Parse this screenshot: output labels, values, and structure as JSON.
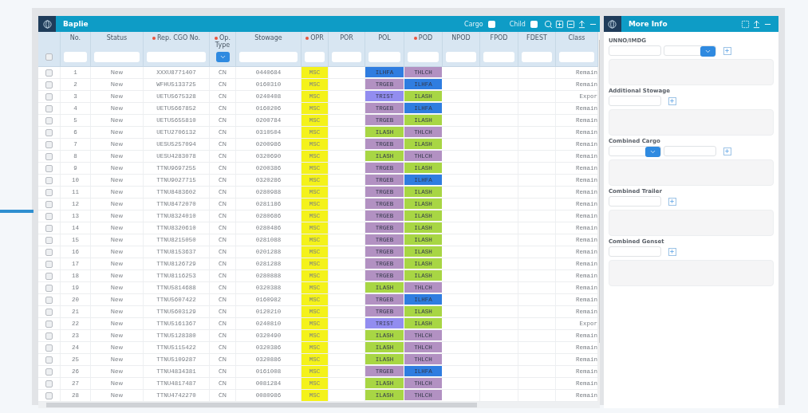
{
  "grid": {
    "title": "Baplie",
    "toggles": [
      {
        "label": "Cargo",
        "checked": false
      },
      {
        "label": "Child",
        "checked": false
      }
    ],
    "select_all": {
      "checked": false
    },
    "columns": [
      {
        "label": "No.",
        "required": false,
        "dropdown_filter": false
      },
      {
        "label": "Status",
        "required": false,
        "dropdown_filter": false
      },
      {
        "label": "Rep. CGO No.",
        "required": true,
        "dropdown_filter": false
      },
      {
        "label": "Op. Type",
        "required": true,
        "dropdown_filter": true
      },
      {
        "label": "Stowage",
        "required": false,
        "dropdown_filter": false
      },
      {
        "label": "OPR",
        "required": true,
        "dropdown_filter": false
      },
      {
        "label": "POR",
        "required": false,
        "dropdown_filter": false
      },
      {
        "label": "POL",
        "required": false,
        "dropdown_filter": false
      },
      {
        "label": "POD",
        "required": true,
        "dropdown_filter": false
      },
      {
        "label": "NPOD",
        "required": false,
        "dropdown_filter": false
      },
      {
        "label": "FPOD",
        "required": false,
        "dropdown_filter": false
      },
      {
        "label": "FDEST",
        "required": false,
        "dropdown_filter": false
      },
      {
        "label": "Class",
        "required": false,
        "dropdown_filter": false
      }
    ],
    "rows": [
      {
        "checked": false,
        "no": "1",
        "status": "New",
        "rep_cgo_no": "XXXU8771407",
        "op_type": "CN",
        "stowage": "0440684",
        "opr": "MSC",
        "pol": {
          "text": "ILHFA",
          "color": "#2f7de0"
        },
        "pod": {
          "text": "THLCH",
          "color": "#b291c2"
        },
        "class": "Remain"
      },
      {
        "checked": false,
        "no": "2",
        "status": "New",
        "rep_cgo_no": "WFHU5133725",
        "op_type": "CN",
        "stowage": "0160310",
        "opr": "MSC",
        "pol": {
          "text": "TRGEB",
          "color": "#b291c2"
        },
        "pod": {
          "text": "ILHFA",
          "color": "#2f7de0"
        },
        "class": "Remain"
      },
      {
        "checked": false,
        "no": "3",
        "status": "New",
        "rep_cgo_no": "UETU5675328",
        "op_type": "CN",
        "stowage": "0240408",
        "opr": "MSC",
        "pol": {
          "text": "TRIST",
          "color": "#928df0"
        },
        "pod": {
          "text": "ILASH",
          "color": "#a8d644"
        },
        "class": "Expor"
      },
      {
        "checked": false,
        "no": "4",
        "status": "New",
        "rep_cgo_no": "UETU5667852",
        "op_type": "CN",
        "stowage": "0160206",
        "opr": "MSC",
        "pol": {
          "text": "TRGEB",
          "color": "#b291c2"
        },
        "pod": {
          "text": "ILHFA",
          "color": "#2f7de0"
        },
        "class": "Remain"
      },
      {
        "checked": false,
        "no": "5",
        "status": "New",
        "rep_cgo_no": "UETU5655810",
        "op_type": "CN",
        "stowage": "0200784",
        "opr": "MSC",
        "pol": {
          "text": "TRGEB",
          "color": "#b291c2"
        },
        "pod": {
          "text": "ILASH",
          "color": "#a8d644"
        },
        "class": "Remain"
      },
      {
        "checked": false,
        "no": "6",
        "status": "New",
        "rep_cgo_no": "UETU2706132",
        "op_type": "CN",
        "stowage": "0310504",
        "opr": "MSC",
        "pol": {
          "text": "ILASH",
          "color": "#a8d644"
        },
        "pod": {
          "text": "THLCH",
          "color": "#b291c2"
        },
        "class": "Remain"
      },
      {
        "checked": false,
        "no": "7",
        "status": "New",
        "rep_cgo_no": "UESU5257094",
        "op_type": "CN",
        "stowage": "0200986",
        "opr": "MSC",
        "pol": {
          "text": "TRGEB",
          "color": "#b291c2"
        },
        "pod": {
          "text": "ILASH",
          "color": "#a8d644"
        },
        "class": "Remain"
      },
      {
        "checked": false,
        "no": "8",
        "status": "New",
        "rep_cgo_no": "UESU4283078",
        "op_type": "CN",
        "stowage": "0320690",
        "opr": "MSC",
        "pol": {
          "text": "ILASH",
          "color": "#a8d644"
        },
        "pod": {
          "text": "THLCH",
          "color": "#b291c2"
        },
        "class": "Remain"
      },
      {
        "checked": false,
        "no": "9",
        "status": "New",
        "rep_cgo_no": "TTNU9697255",
        "op_type": "CN",
        "stowage": "0200386",
        "opr": "MSC",
        "pol": {
          "text": "TRGEB",
          "color": "#b291c2"
        },
        "pod": {
          "text": "ILASH",
          "color": "#a8d644"
        },
        "class": "Remain"
      },
      {
        "checked": false,
        "no": "10",
        "status": "New",
        "rep_cgo_no": "TTNU9027715",
        "op_type": "CN",
        "stowage": "0320286",
        "opr": "MSC",
        "pol": {
          "text": "TRGEB",
          "color": "#b291c2"
        },
        "pod": {
          "text": "ILHFA",
          "color": "#2f7de0"
        },
        "class": "Remain"
      },
      {
        "checked": false,
        "no": "11",
        "status": "New",
        "rep_cgo_no": "TTNU8483602",
        "op_type": "CN",
        "stowage": "0280988",
        "opr": "MSC",
        "pol": {
          "text": "TRGEB",
          "color": "#b291c2"
        },
        "pod": {
          "text": "ILASH",
          "color": "#a8d644"
        },
        "class": "Remain"
      },
      {
        "checked": false,
        "no": "12",
        "status": "New",
        "rep_cgo_no": "TTNU8472070",
        "op_type": "CN",
        "stowage": "0281186",
        "opr": "MSC",
        "pol": {
          "text": "TRGEB",
          "color": "#b291c2"
        },
        "pod": {
          "text": "ILASH",
          "color": "#a8d644"
        },
        "class": "Remain"
      },
      {
        "checked": false,
        "no": "13",
        "status": "New",
        "rep_cgo_no": "TTNU8324010",
        "op_type": "CN",
        "stowage": "0280686",
        "opr": "MSC",
        "pol": {
          "text": "TRGEB",
          "color": "#b291c2"
        },
        "pod": {
          "text": "ILASH",
          "color": "#a8d644"
        },
        "class": "Remain"
      },
      {
        "checked": false,
        "no": "14",
        "status": "New",
        "rep_cgo_no": "TTNU8320610",
        "op_type": "CN",
        "stowage": "0280486",
        "opr": "MSC",
        "pol": {
          "text": "TRGEB",
          "color": "#b291c2"
        },
        "pod": {
          "text": "ILASH",
          "color": "#a8d644"
        },
        "class": "Remain"
      },
      {
        "checked": false,
        "no": "15",
        "status": "New",
        "rep_cgo_no": "TTNU8215050",
        "op_type": "CN",
        "stowage": "0281088",
        "opr": "MSC",
        "pol": {
          "text": "TRGEB",
          "color": "#b291c2"
        },
        "pod": {
          "text": "ILASH",
          "color": "#a8d644"
        },
        "class": "Remain"
      },
      {
        "checked": false,
        "no": "16",
        "status": "New",
        "rep_cgo_no": "TTNU8153637",
        "op_type": "CN",
        "stowage": "0201288",
        "opr": "MSC",
        "pol": {
          "text": "TRGEB",
          "color": "#b291c2"
        },
        "pod": {
          "text": "ILASH",
          "color": "#a8d644"
        },
        "class": "Remain"
      },
      {
        "checked": false,
        "no": "17",
        "status": "New",
        "rep_cgo_no": "TTNU8126729",
        "op_type": "CN",
        "stowage": "0281288",
        "opr": "MSC",
        "pol": {
          "text": "TRGEB",
          "color": "#b291c2"
        },
        "pod": {
          "text": "ILASH",
          "color": "#a8d644"
        },
        "class": "Remain"
      },
      {
        "checked": false,
        "no": "18",
        "status": "New",
        "rep_cgo_no": "TTNU8116253",
        "op_type": "CN",
        "stowage": "0280888",
        "opr": "MSC",
        "pol": {
          "text": "TRGEB",
          "color": "#b291c2"
        },
        "pod": {
          "text": "ILASH",
          "color": "#a8d644"
        },
        "class": "Remain"
      },
      {
        "checked": false,
        "no": "19",
        "status": "New",
        "rep_cgo_no": "TTNU5814688",
        "op_type": "CN",
        "stowage": "0320388",
        "opr": "MSC",
        "pol": {
          "text": "ILASH",
          "color": "#a8d644"
        },
        "pod": {
          "text": "THLCH",
          "color": "#b291c2"
        },
        "class": "Remain"
      },
      {
        "checked": false,
        "no": "20",
        "status": "New",
        "rep_cgo_no": "TTNU5607422",
        "op_type": "CN",
        "stowage": "0160982",
        "opr": "MSC",
        "pol": {
          "text": "TRGEB",
          "color": "#b291c2"
        },
        "pod": {
          "text": "ILHFA",
          "color": "#2f7de0"
        },
        "class": "Remain"
      },
      {
        "checked": false,
        "no": "21",
        "status": "New",
        "rep_cgo_no": "TTNU5603129",
        "op_type": "CN",
        "stowage": "0120210",
        "opr": "MSC",
        "pol": {
          "text": "TRGEB",
          "color": "#b291c2"
        },
        "pod": {
          "text": "ILASH",
          "color": "#a8d644"
        },
        "class": "Remain"
      },
      {
        "checked": false,
        "no": "22",
        "status": "New",
        "rep_cgo_no": "TTNU5161367",
        "op_type": "CN",
        "stowage": "0240810",
        "opr": "MSC",
        "pol": {
          "text": "TRIST",
          "color": "#928df0"
        },
        "pod": {
          "text": "ILASH",
          "color": "#a8d644"
        },
        "class": "Expor"
      },
      {
        "checked": false,
        "no": "23",
        "status": "New",
        "rep_cgo_no": "TTNU5128380",
        "op_type": "CN",
        "stowage": "0320490",
        "opr": "MSC",
        "pol": {
          "text": "ILASH",
          "color": "#a8d644"
        },
        "pod": {
          "text": "THLCH",
          "color": "#b291c2"
        },
        "class": "Remain"
      },
      {
        "checked": false,
        "no": "24",
        "status": "New",
        "rep_cgo_no": "TTNU5115422",
        "op_type": "CN",
        "stowage": "0320386",
        "opr": "MSC",
        "pol": {
          "text": "ILASH",
          "color": "#a8d644"
        },
        "pod": {
          "text": "THLCH",
          "color": "#b291c2"
        },
        "class": "Remain"
      },
      {
        "checked": false,
        "no": "25",
        "status": "New",
        "rep_cgo_no": "TTNU5109287",
        "op_type": "CN",
        "stowage": "0320886",
        "opr": "MSC",
        "pol": {
          "text": "ILASH",
          "color": "#a8d644"
        },
        "pod": {
          "text": "THLCH",
          "color": "#b291c2"
        },
        "class": "Remain"
      },
      {
        "checked": false,
        "no": "26",
        "status": "New",
        "rep_cgo_no": "TTNU4834381",
        "op_type": "CN",
        "stowage": "0161008",
        "opr": "MSC",
        "pol": {
          "text": "TRGEB",
          "color": "#b291c2"
        },
        "pod": {
          "text": "ILHFA",
          "color": "#2f7de0"
        },
        "class": "Remain"
      },
      {
        "checked": false,
        "no": "27",
        "status": "New",
        "rep_cgo_no": "TTNU4817487",
        "op_type": "CN",
        "stowage": "0081284",
        "opr": "MSC",
        "pol": {
          "text": "ILASH",
          "color": "#a8d644"
        },
        "pod": {
          "text": "THLCH",
          "color": "#b291c2"
        },
        "class": "Remain"
      },
      {
        "checked": false,
        "no": "28",
        "status": "New",
        "rep_cgo_no": "TTNU4742270",
        "op_type": "CN",
        "stowage": "0080986",
        "opr": "MSC",
        "pol": {
          "text": "ILASH",
          "color": "#a8d644"
        },
        "pod": {
          "text": "THLCH",
          "color": "#b291c2"
        },
        "class": "Remain"
      }
    ]
  },
  "more_info": {
    "title": "More Info",
    "sections": [
      {
        "label": "UNNO/IMDG",
        "controls": [
          {
            "kind": "input"
          },
          {
            "kind": "select"
          }
        ]
      },
      {
        "label": "Additional Stowage",
        "controls": [
          {
            "kind": "input"
          }
        ]
      },
      {
        "label": "Combined Cargo",
        "controls": [
          {
            "kind": "select"
          },
          {
            "kind": "input"
          }
        ]
      },
      {
        "label": "Combined Trailer",
        "controls": [
          {
            "kind": "input"
          }
        ]
      },
      {
        "label": "Combined Genset",
        "controls": [
          {
            "kind": "input"
          }
        ]
      }
    ]
  }
}
